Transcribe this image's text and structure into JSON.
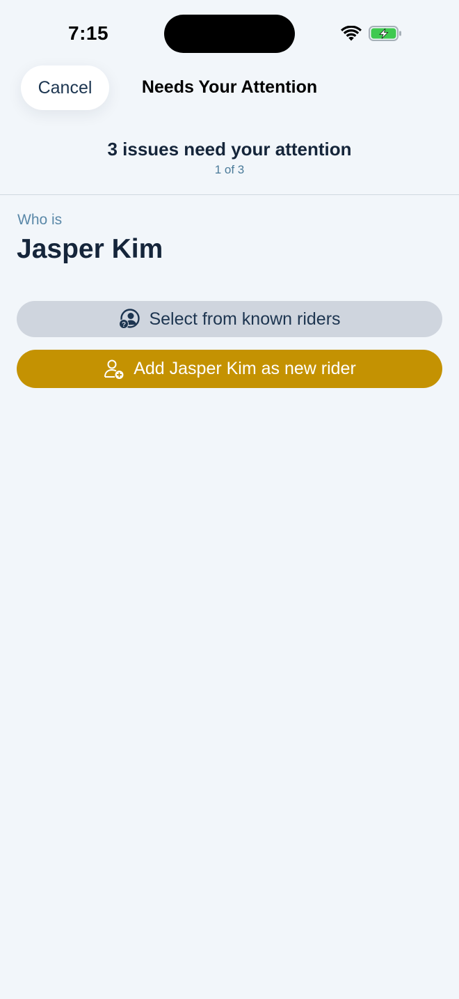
{
  "status_bar": {
    "time": "7:15",
    "wifi_icon": "wifi-icon",
    "battery_icon": "battery-charging-icon",
    "battery_color": "#3ec94f"
  },
  "nav": {
    "cancel_label": "Cancel",
    "title": "Needs Your Attention"
  },
  "progress": {
    "title": "3 issues need your attention",
    "count": "1 of 3"
  },
  "question": {
    "label": "Who is",
    "name": "Jasper Kim"
  },
  "actions": {
    "select_known": {
      "label": "Select from known riders",
      "icon": "person-question-icon",
      "background": "#cfd5de"
    },
    "add_new": {
      "label": "Add Jasper Kim as new rider",
      "icon": "person-add-icon",
      "background": "#c49202"
    }
  }
}
